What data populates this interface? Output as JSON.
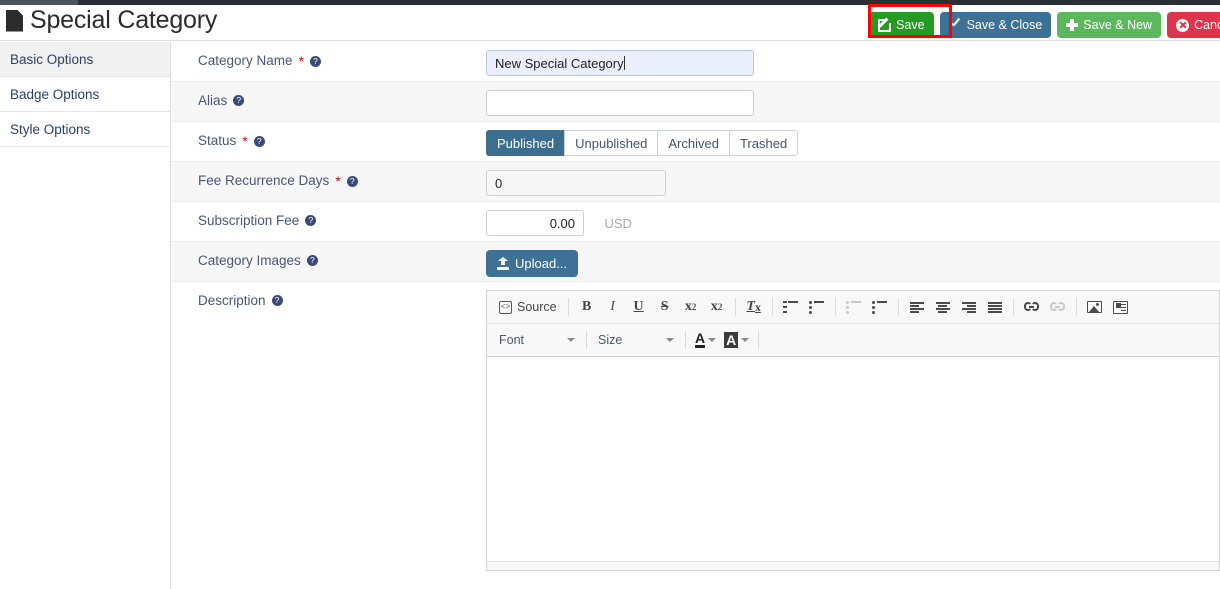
{
  "header": {
    "title": "Special Category",
    "title_icon": "document-icon",
    "actions": [
      {
        "label": "Save",
        "icon": "edit-square-icon",
        "color": "#259b24"
      },
      {
        "label": "Save & Close",
        "icon": "check-icon",
        "color": "#3d7196"
      },
      {
        "label": "Save & New",
        "icon": "plus-icon",
        "color": "#5cb85c"
      },
      {
        "label": "Cancel",
        "icon": "x-circle-icon",
        "color": "#e0344b"
      }
    ],
    "highlight_color": "#ff0000",
    "highlighted_action": "Save"
  },
  "sidebar": {
    "items": [
      {
        "label": "Basic Options",
        "active": true
      },
      {
        "label": "Badge Options",
        "active": false
      },
      {
        "label": "Style Options",
        "active": false
      }
    ]
  },
  "form": {
    "help_glyph": "?",
    "required_glyph": "*",
    "rows": [
      {
        "label": "Category Name",
        "required": true,
        "help": true,
        "value": "New Special Category",
        "placeholder": "",
        "focused": true
      },
      {
        "label": "Alias",
        "required": false,
        "help": true,
        "value": "",
        "placeholder": "",
        "focused": false
      },
      {
        "label": "Status",
        "required": true,
        "help": true,
        "options": [
          "Published",
          "Unpublished",
          "Archived",
          "Trashed"
        ],
        "selected": "Published"
      },
      {
        "label": "Fee Recurrence Days",
        "required": true,
        "help": true,
        "value": "0",
        "placeholder": ""
      },
      {
        "label": "Subscription Fee",
        "required": false,
        "help": true,
        "value": "0.00",
        "currency": "USD"
      },
      {
        "label": "Category Images",
        "required": false,
        "help": true,
        "upload_label": "Upload...",
        "upload_icon": "upload-icon"
      },
      {
        "label": "Description",
        "required": false,
        "help": true
      }
    ]
  },
  "editor": {
    "source_label": "Source",
    "source_icon": "source-code-icon",
    "buttons_row1": [
      {
        "name": "bold-icon",
        "glyph": "B"
      },
      {
        "name": "italic-icon",
        "glyph": "I"
      },
      {
        "name": "underline-icon",
        "glyph": "U"
      },
      {
        "name": "strikethrough-icon",
        "glyph": "S"
      },
      {
        "name": "subscript-icon",
        "glyph": "x₂"
      },
      {
        "name": "superscript-icon",
        "glyph": "x²"
      },
      {
        "name": "remove-format-icon",
        "glyph": "Tx"
      },
      {
        "name": "numbered-list-icon",
        "glyph": ""
      },
      {
        "name": "bulleted-list-icon",
        "glyph": ""
      },
      {
        "name": "outdent-icon",
        "glyph": "",
        "disabled": true
      },
      {
        "name": "indent-icon",
        "glyph": ""
      },
      {
        "name": "align-left-icon",
        "glyph": ""
      },
      {
        "name": "align-center-icon",
        "glyph": ""
      },
      {
        "name": "align-right-icon",
        "glyph": ""
      },
      {
        "name": "justify-icon",
        "glyph": ""
      },
      {
        "name": "link-icon",
        "glyph": ""
      },
      {
        "name": "unlink-icon",
        "glyph": "",
        "disabled": true
      },
      {
        "name": "image-icon",
        "glyph": ""
      },
      {
        "name": "template-icon",
        "glyph": ""
      }
    ],
    "font_label": "Font",
    "size_label": "Size",
    "text_color_glyph": "A",
    "bg_color_glyph": "A",
    "content": ""
  }
}
